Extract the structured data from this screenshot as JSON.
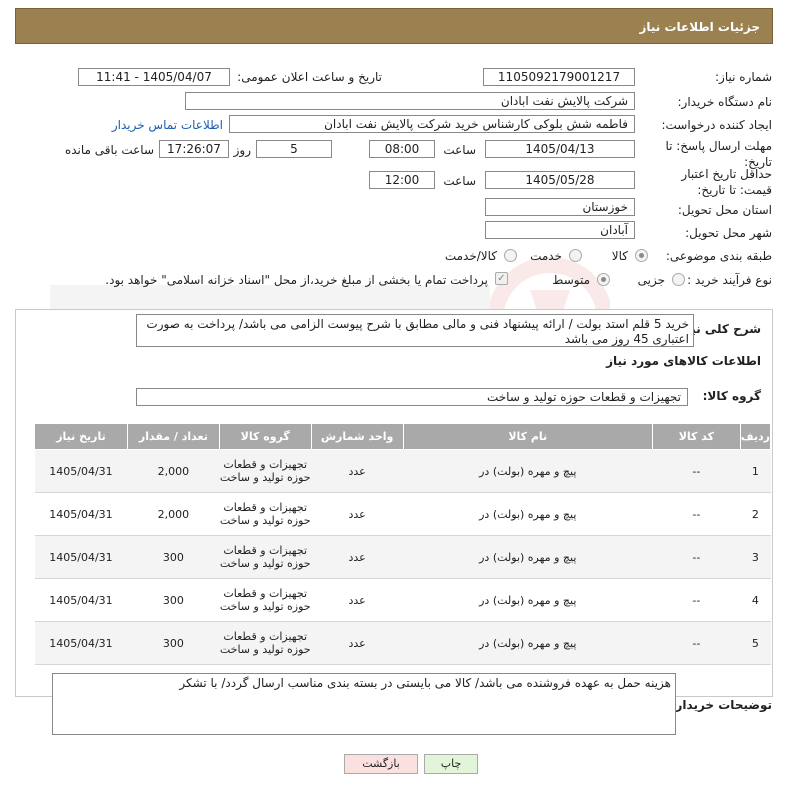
{
  "header": {
    "title": "جزئیات اطلاعات نیاز"
  },
  "form": {
    "need_number_label": "شماره نیاز:",
    "need_number": "1105092179001217",
    "announce_label": "تاریخ و ساعت اعلان عمومی:",
    "announce_value": "1405/04/07 - 11:41",
    "buyer_label": "نام دستگاه خریدار:",
    "buyer_value": "شرکت پالایش نفت ابادان",
    "creator_label": "ایجاد کننده درخواست:",
    "creator_value": "فاطمه شش بلوکی کارشناس خرید شرکت پالایش نفت ابادان",
    "contact_link": "اطلاعات تماس خریدار",
    "deadline_label": "مهلت ارسال پاسخ: تا تاریخ:",
    "deadline_date": "1405/04/13",
    "time_label": "ساعت",
    "deadline_time": "08:00",
    "days_value": "5",
    "days_label": "روز و",
    "remaining_time": "17:26:07",
    "remaining_label": "ساعت باقی مانده",
    "validity_label": "حداقل تاریخ اعتبار قیمت: تا تاریخ:",
    "validity_date": "1405/05/28",
    "validity_time": "12:00",
    "province_label": "استان محل تحویل:",
    "province_value": "خوزستان",
    "city_label": "شهر محل تحویل:",
    "city_value": "آبادان",
    "category_label": "طبقه بندی موضوعی:",
    "category_options": [
      "کالا",
      "خدمت",
      "کالا/خدمت"
    ],
    "category_selected": "کالا",
    "process_label": "نوع فرآیند خرید :",
    "process_options": [
      "جزیی",
      "متوسط"
    ],
    "process_selected": "متوسط",
    "payment_text": "پرداخت تمام یا بخشی از مبلغ خرید،از محل \"اسناد خزانه اسلامی\" خواهد بود."
  },
  "summary": {
    "label": "شرح کلی نیاز:",
    "text": "خرید 5 قلم استد بولت / ارائه پیشنهاد فنی و مالی مطابق با شرح پیوست الزامی می باشد/ پرداخت به صورت اعتباری 45 روز می باشد"
  },
  "goods": {
    "section_title": "اطلاعات کالاهای مورد نیاز",
    "group_label": "گروه کالا:",
    "group_value": "تجهیزات و قطعات حوزه تولید و ساخت"
  },
  "table": {
    "headers": [
      "ردیف",
      "کد کالا",
      "نام کالا",
      "واحد شمارش",
      "گروه کالا",
      "تعداد / مقدار",
      "تاریخ نیاز"
    ],
    "rows": [
      [
        "1",
        "--",
        "پیچ و مهره (بولت) در",
        "عدد",
        "تجهیزات و قطعات حوزه تولید و ساخت",
        "2,000",
        "1405/04/31"
      ],
      [
        "2",
        "--",
        "پیچ و مهره (بولت) در",
        "عدد",
        "تجهیزات و قطعات حوزه تولید و ساخت",
        "2,000",
        "1405/04/31"
      ],
      [
        "3",
        "--",
        "پیچ و مهره (بولت) در",
        "عدد",
        "تجهیزات و قطعات حوزه تولید و ساخت",
        "300",
        "1405/04/31"
      ],
      [
        "4",
        "--",
        "پیچ و مهره (بولت) در",
        "عدد",
        "تجهیزات و قطعات حوزه تولید و ساخت",
        "300",
        "1405/04/31"
      ],
      [
        "5",
        "--",
        "پیچ و مهره (بولت) در",
        "عدد",
        "تجهیزات و قطعات حوزه تولید و ساخت",
        "300",
        "1405/04/31"
      ]
    ]
  },
  "buyer_notes": {
    "label": "توضیحات خریدار:",
    "text": "هزینه حمل به عهده فروشنده می باشد/ کالا می بایستی در بسته بندی مناسب ارسال گردد/ با تشکر"
  },
  "buttons": {
    "print": "چاپ",
    "back": "بازگشت"
  },
  "colors": {
    "header": "#9b8050",
    "table_header": "#a9a9a9",
    "print_btn": "#e3f5d8",
    "back_btn": "#fbe0e0"
  }
}
